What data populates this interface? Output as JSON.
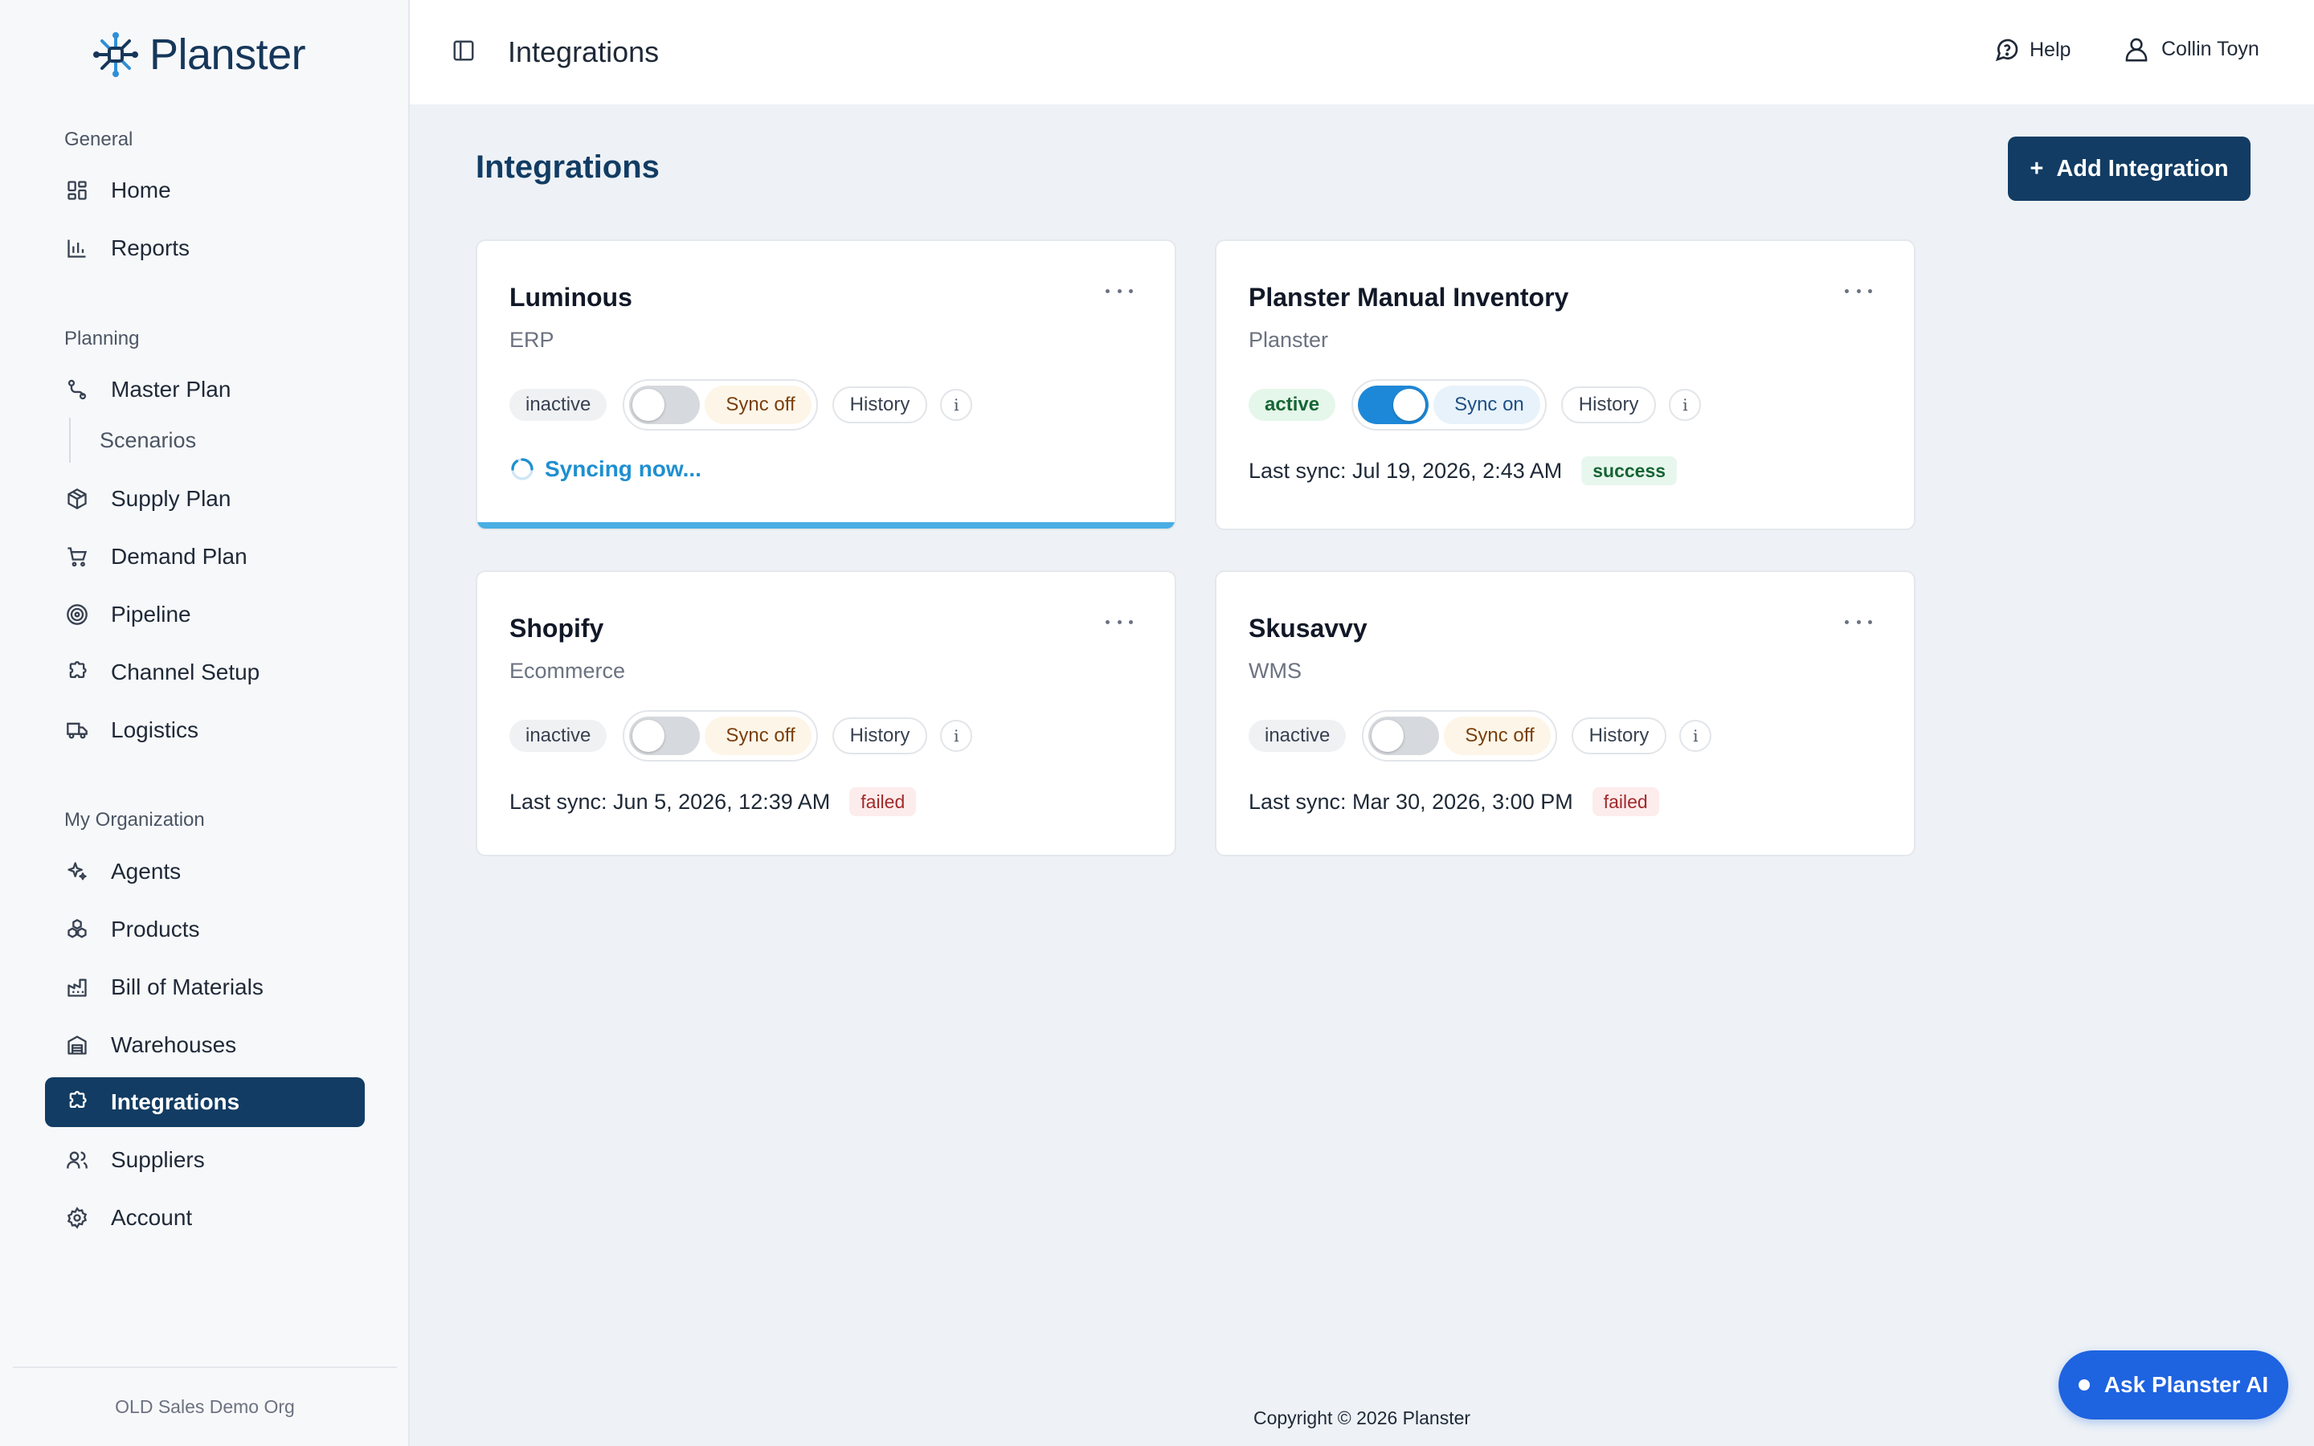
{
  "app": {
    "name": "Planster"
  },
  "sidebar": {
    "sections": [
      {
        "label": "General"
      },
      {
        "label": "Planning"
      },
      {
        "label": "My Organization"
      }
    ],
    "items": [
      {
        "label": "Home",
        "icon": "grid-icon"
      },
      {
        "label": "Reports",
        "icon": "bar-chart-icon"
      },
      {
        "label": "Master Plan",
        "icon": "route-icon"
      },
      {
        "label": "Scenarios"
      },
      {
        "label": "Supply Plan",
        "icon": "package-icon"
      },
      {
        "label": "Demand Plan",
        "icon": "cart-icon"
      },
      {
        "label": "Pipeline",
        "icon": "target-icon"
      },
      {
        "label": "Channel Setup",
        "icon": "puzzle-icon"
      },
      {
        "label": "Logistics",
        "icon": "truck-icon"
      },
      {
        "label": "Agents",
        "icon": "sparkles-icon"
      },
      {
        "label": "Products",
        "icon": "boxes-icon"
      },
      {
        "label": "Bill of Materials",
        "icon": "factory-icon"
      },
      {
        "label": "Warehouses",
        "icon": "warehouse-icon"
      },
      {
        "label": "Integrations",
        "icon": "puzzle-icon",
        "active": true
      },
      {
        "label": "Suppliers",
        "icon": "users-icon"
      },
      {
        "label": "Account",
        "icon": "gear-icon"
      }
    ],
    "org_name": "OLD Sales Demo Org"
  },
  "header": {
    "title": "Integrations",
    "help_label": "Help",
    "user_name": "Collin Toyn"
  },
  "main": {
    "title": "Integrations",
    "add_button_label": "Add Integration",
    "add_button_icon": "+",
    "cards": [
      {
        "name": "Luminous",
        "type": "ERP",
        "status": "inactive",
        "sync_enabled": false,
        "sync_label": "Sync off",
        "history_label": "History",
        "info_label": "i",
        "syncing_text": "Syncing now..."
      },
      {
        "name": "Planster Manual Inventory",
        "type": "Planster",
        "status": "active",
        "sync_enabled": true,
        "sync_label": "Sync on",
        "history_label": "History",
        "info_label": "i",
        "last_sync": "Last sync: Jul 19, 2026, 2:43 AM",
        "result": "success"
      },
      {
        "name": "Shopify",
        "type": "Ecommerce",
        "status": "inactive",
        "sync_enabled": false,
        "sync_label": "Sync off",
        "history_label": "History",
        "info_label": "i",
        "last_sync": "Last sync: Jun 5, 2026, 12:39 AM",
        "result": "failed"
      },
      {
        "name": "Skusavvy",
        "type": "WMS",
        "status": "inactive",
        "sync_enabled": false,
        "sync_label": "Sync off",
        "history_label": "History",
        "info_label": "i",
        "last_sync": "Last sync: Mar 30, 2026, 3:00 PM",
        "result": "failed"
      }
    ]
  },
  "footer": {
    "copyright": "Copyright © 2026 Planster"
  },
  "ask_ai": {
    "label": "Ask Planster AI"
  },
  "colors": {
    "brand": "#123c63",
    "accent": "#1e88d8",
    "ask_ai": "#1e63e0",
    "success": "#166534",
    "failed": "#a12b2b"
  }
}
